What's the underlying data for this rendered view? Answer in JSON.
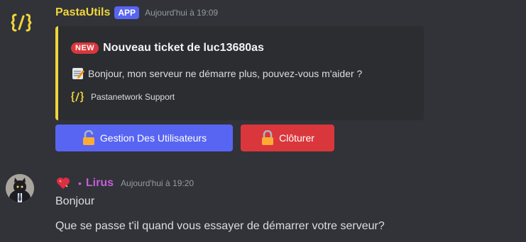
{
  "messages": [
    {
      "author": "PastaUtils",
      "badge": "APP",
      "timestamp": "Aujourd'hui à 19:09",
      "avatar_icon": "pastautils-logo-icon",
      "embed": {
        "accent_color": "#f0d53c",
        "new_badge": "NEW",
        "title": "Nouveau ticket de luc13680as",
        "description": "Bonjour, mon serveur ne démarre plus, pouvez-vous m'aider ?",
        "description_icon": "memo-icon",
        "footer": "Pastanetwork Support",
        "footer_icon": "pastautils-logo-icon"
      },
      "buttons": [
        {
          "label": "Gestion Des Utilisateurs",
          "icon": "unlock-icon",
          "color": "#5865f2"
        },
        {
          "label": "Clôturer",
          "icon": "lock-icon",
          "color": "#da373c"
        }
      ]
    },
    {
      "author_prefix": "•",
      "author": "Lirus",
      "author_color": "#c45fd6",
      "role_icon": "heart-icon",
      "timestamp": "Aujourd'hui à 19:20",
      "lines": [
        "Bonjour",
        "Que se passe t'il quand vous essayer de démarrer votre serveur?"
      ]
    }
  ]
}
